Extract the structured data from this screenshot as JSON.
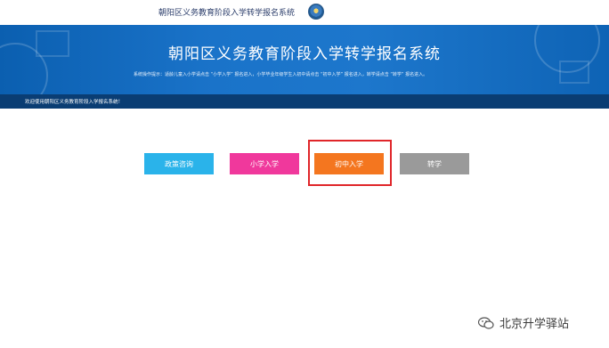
{
  "header": {
    "site_title": "朝阳区义务教育阶段入学转学报名系统"
  },
  "banner": {
    "title": "朝阳区义务教育阶段入学转学报名系统",
    "notice": "系统操作提示：适龄儿童入小学请点击 “小学入学” 报名进入，小学毕业年级学生入初中请点击 “初中入学” 报名进入，转学请点击 “转学” 报名进入。"
  },
  "welcome_bar": {
    "text": "欢迎使用朝阳区义务教育阶段入学报名系统！"
  },
  "buttons": {
    "policy": "政策咨询",
    "primary": "小学入学",
    "junior": "初中入学",
    "transfer": "转学"
  },
  "colors": {
    "policy": "#2ab3ea",
    "primary": "#f0389c",
    "junior": "#f4761f",
    "transfer": "#9a9a9a",
    "highlight": "#e0262a",
    "banner": "#1a73c9"
  },
  "watermark": {
    "text": "北京升学驿站"
  }
}
